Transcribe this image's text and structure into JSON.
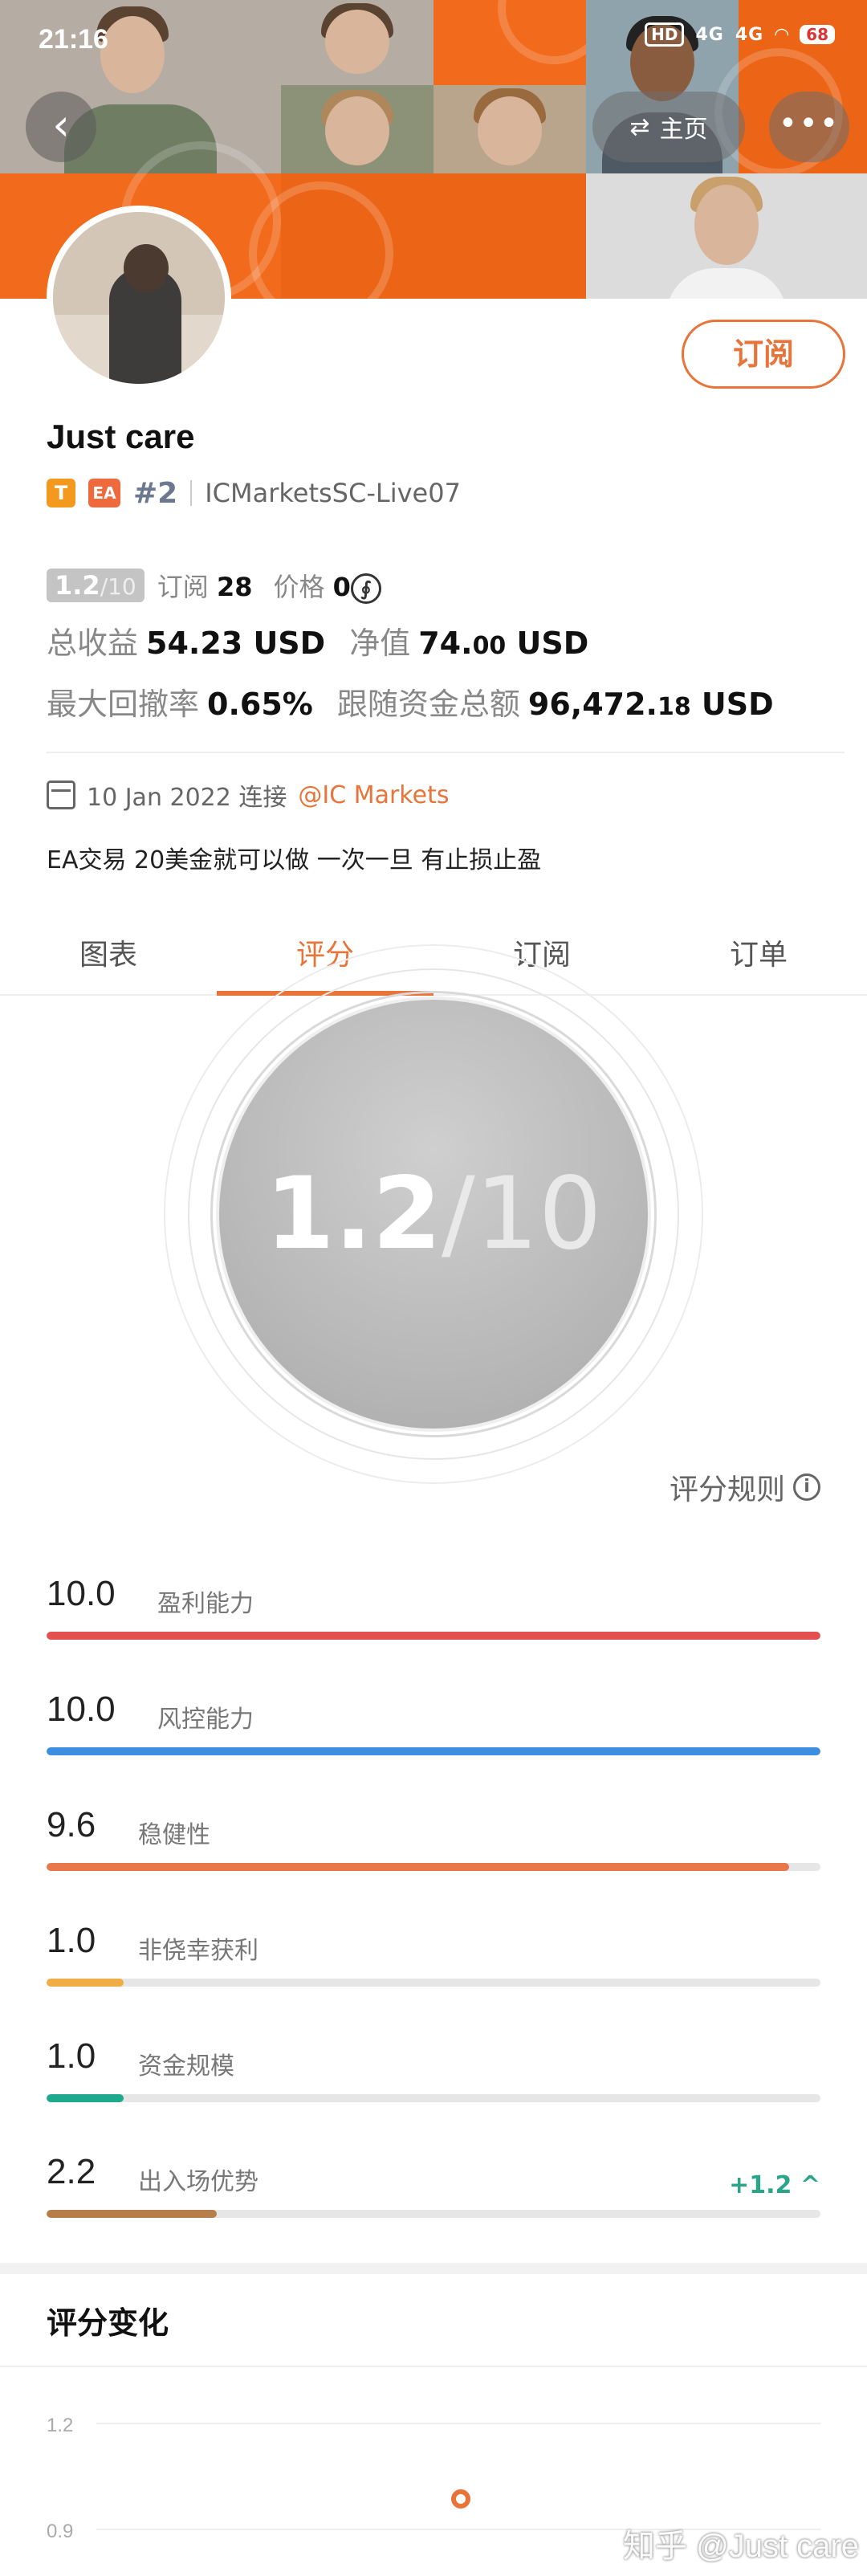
{
  "status_bar": {
    "time": "21:16",
    "hd": "HD",
    "signal1": "4G",
    "signal2": "4G",
    "battery": "68"
  },
  "nav": {
    "back_glyph": "‹",
    "home_label": "主页",
    "switch_icon": "⇄",
    "more_glyph": "•••"
  },
  "profile": {
    "name": "Just care",
    "tag_t": "T",
    "tag_ea": "EA",
    "rank": "#2",
    "server": "ICMarketsSC-Live07",
    "subscribe_label": "订阅"
  },
  "summary": {
    "score_num": "1.2",
    "score_den": "/10",
    "subs_label": "订阅",
    "subs_value": "28",
    "price_label": "价格",
    "price_value": "0",
    "coin_glyph": "∮",
    "total_profit_label": "总收益",
    "total_profit_value": "54.23 USD",
    "equity_label": "净值",
    "equity_main": "74.",
    "equity_dec": "00",
    "equity_unit": " USD",
    "max_dd_label": "最大回撤率",
    "max_dd_value": "0.65%",
    "follow_label": "跟随资金总额",
    "follow_main": "96,472.",
    "follow_dec": "18",
    "follow_unit": " USD"
  },
  "connect": {
    "date": "10 Jan 2022 连接",
    "broker": "@IC Markets"
  },
  "description": "EA交易 20美金就可以做 一次一旦 有止损止盈",
  "tabs": [
    {
      "label": "图表"
    },
    {
      "label": "评分"
    },
    {
      "label": "订阅"
    },
    {
      "label": "订单"
    }
  ],
  "dial": {
    "score": "1.2",
    "den": "/10"
  },
  "rules_label": "评分规则",
  "metrics": [
    {
      "value": "10.0",
      "label": "盈利能力",
      "fraction": 1.0,
      "color": "#e35050"
    },
    {
      "value": "10.0",
      "label": "风控能力",
      "fraction": 1.0,
      "color": "#3c8ee0"
    },
    {
      "value": "9.6",
      "label": "稳健性",
      "fraction": 0.96,
      "color": "#e8774a"
    },
    {
      "value": "1.0",
      "label": "非侥幸获利",
      "fraction": 0.1,
      "color": "#f0ad45"
    },
    {
      "value": "1.0",
      "label": "资金规模",
      "fraction": 0.1,
      "color": "#1ea88d"
    },
    {
      "value": "2.2",
      "label": "出入场优势",
      "fraction": 0.22,
      "color": "#b77e4a",
      "delta": "+1.2 ^"
    }
  ],
  "history": {
    "title": "评分变化",
    "y_ticks": [
      "1.2",
      "0.9"
    ],
    "point_color": "#e8743a"
  },
  "watermark": "知乎 @Just care"
}
